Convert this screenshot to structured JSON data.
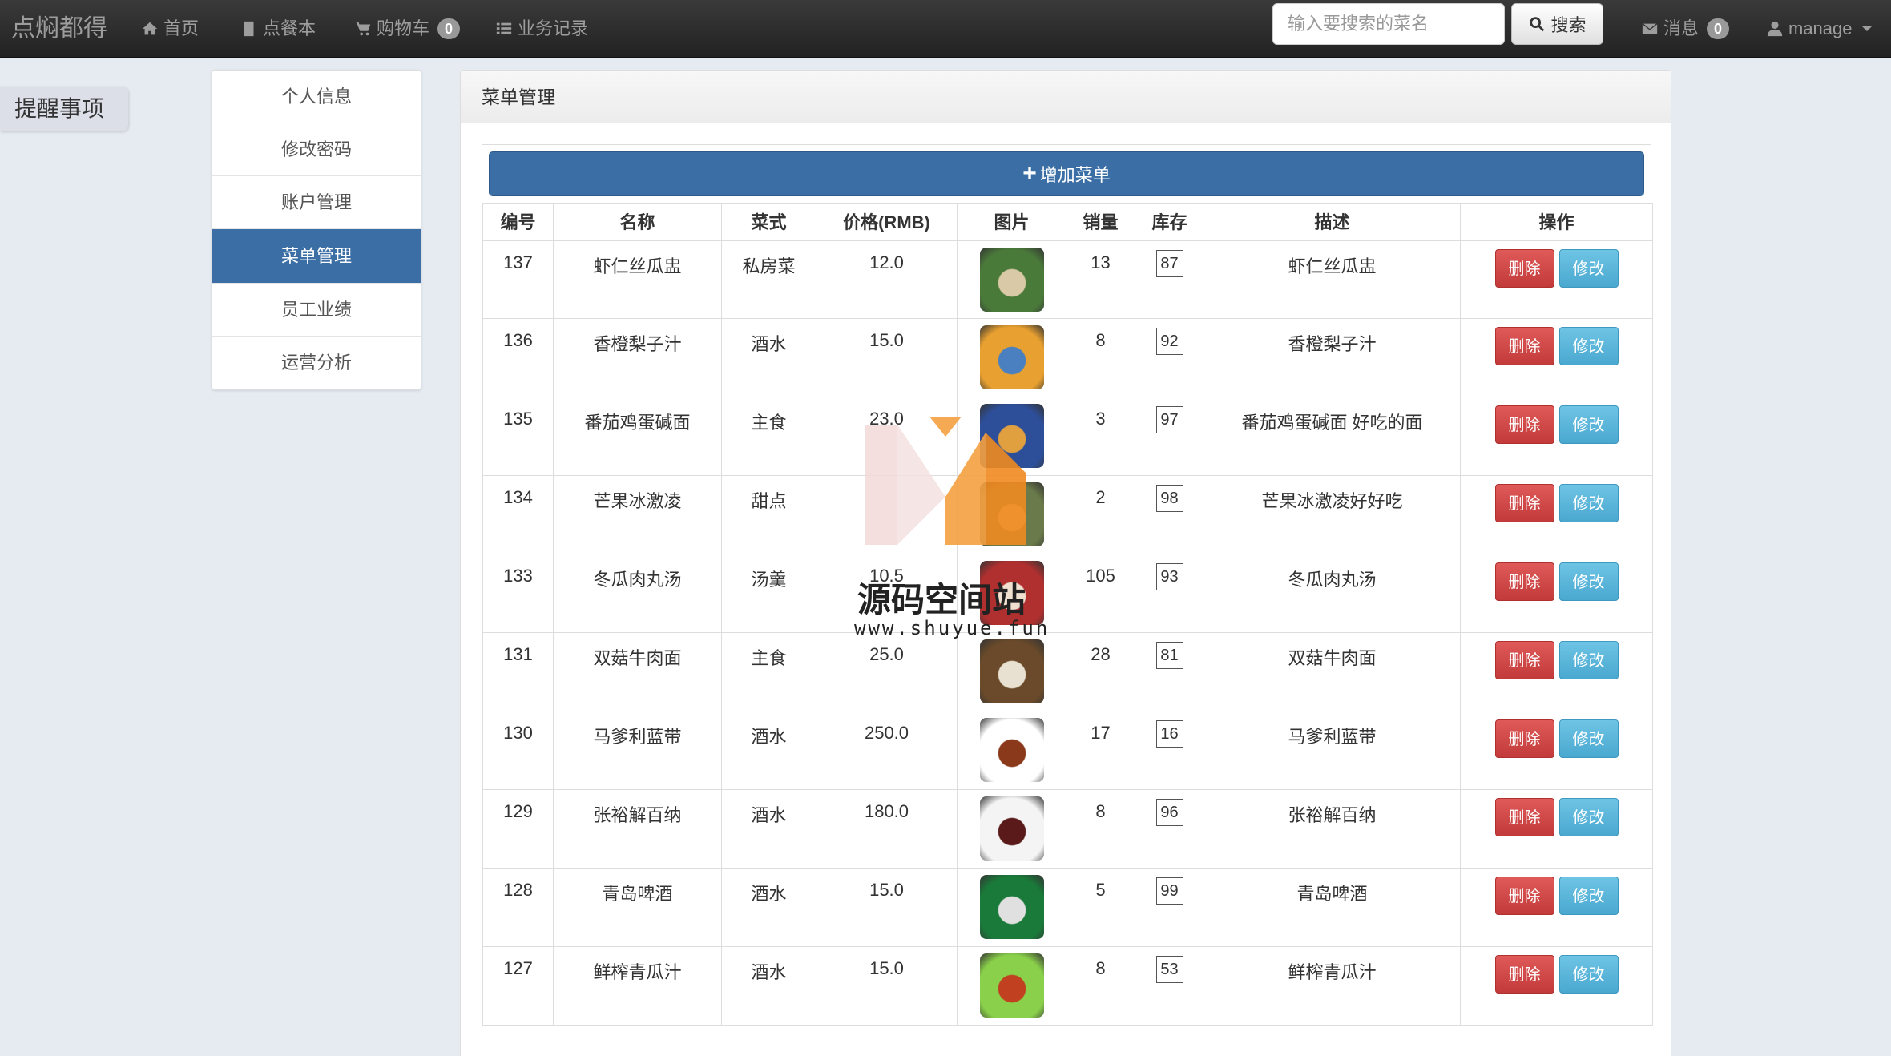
{
  "navbar": {
    "brand": "点焖都得",
    "items": [
      {
        "label": "首页",
        "icon": "home-icon"
      },
      {
        "label": "点餐本",
        "icon": "book-icon"
      },
      {
        "label": "购物车",
        "icon": "cart-icon",
        "badge": "0"
      },
      {
        "label": "业务记录",
        "icon": "list-icon"
      }
    ],
    "search": {
      "placeholder": "输入要搜索的菜名",
      "value": "",
      "button_label": "搜索"
    },
    "messages": {
      "label": "消息",
      "badge": "0"
    },
    "user": {
      "label": "manage"
    }
  },
  "reminder": {
    "label": "提醒事项"
  },
  "sidebar": {
    "items": [
      {
        "label": "个人信息",
        "active": false
      },
      {
        "label": "修改密码",
        "active": false
      },
      {
        "label": "账户管理",
        "active": false
      },
      {
        "label": "菜单管理",
        "active": true
      },
      {
        "label": "员工业绩",
        "active": false
      },
      {
        "label": "运营分析",
        "active": false
      }
    ]
  },
  "panel": {
    "title": "菜单管理",
    "add_button": "增加菜单",
    "columns": [
      "编号",
      "名称",
      "菜式",
      "价格(RMB)",
      "图片",
      "销量",
      "库存",
      "描述",
      "操作"
    ],
    "delete_label": "删除",
    "edit_label": "修改",
    "rows": [
      {
        "id": "137",
        "name": "虾仁丝瓜盅",
        "type": "私房菜",
        "price": "12.0",
        "sales": "13",
        "stock": "87",
        "desc": "虾仁丝瓜盅",
        "img_color": "#4a7a3a",
        "img_accent": "#d9c9a6"
      },
      {
        "id": "136",
        "name": "香橙梨子汁",
        "type": "酒水",
        "price": "15.0",
        "sales": "8",
        "stock": "92",
        "desc": "香橙梨子汁",
        "img_color": "#e8a030",
        "img_accent": "#4a80c0"
      },
      {
        "id": "135",
        "name": "番茄鸡蛋碱面",
        "type": "主食",
        "price": "23.0",
        "sales": "3",
        "stock": "97",
        "desc": "番茄鸡蛋碱面 好吃的面",
        "img_color": "#2d4f9a",
        "img_accent": "#e0a040"
      },
      {
        "id": "134",
        "name": "芒果冰激凌",
        "type": "甜点",
        "price": "",
        "sales": "2",
        "stock": "98",
        "desc": "芒果冰激凌好好吃",
        "img_color": "#6a7a4a",
        "img_accent": "#e8d0a0"
      },
      {
        "id": "133",
        "name": "冬瓜肉丸汤",
        "type": "汤羹",
        "price": "10.5",
        "sales": "105",
        "stock": "93",
        "desc": "冬瓜肉丸汤",
        "img_color": "#b03030",
        "img_accent": "#f0e0d0"
      },
      {
        "id": "131",
        "name": "双菇牛肉面",
        "type": "主食",
        "price": "25.0",
        "sales": "28",
        "stock": "81",
        "desc": "双菇牛肉面",
        "img_color": "#6a4a2a",
        "img_accent": "#e8e0d0"
      },
      {
        "id": "130",
        "name": "马爹利蓝带",
        "type": "酒水",
        "price": "250.0",
        "sales": "17",
        "stock": "16",
        "desc": "马爹利蓝带",
        "img_color": "#ffffff",
        "img_accent": "#8a3a1a"
      },
      {
        "id": "129",
        "name": "张裕解百纳",
        "type": "酒水",
        "price": "180.0",
        "sales": "8",
        "stock": "96",
        "desc": "张裕解百纳",
        "img_color": "#f4f4f4",
        "img_accent": "#5a1a1a"
      },
      {
        "id": "128",
        "name": "青岛啤酒",
        "type": "酒水",
        "price": "15.0",
        "sales": "5",
        "stock": "99",
        "desc": "青岛啤酒",
        "img_color": "#1a7a3a",
        "img_accent": "#e0e0e0"
      },
      {
        "id": "127",
        "name": "鲜榨青瓜汁",
        "type": "酒水",
        "price": "15.0",
        "sales": "8",
        "stock": "53",
        "desc": "鲜榨青瓜汁",
        "img_color": "#8ad04a",
        "img_accent": "#c04020"
      }
    ]
  },
  "watermark": {
    "text": "源码空间站",
    "url": "www.shuyue.fun"
  }
}
